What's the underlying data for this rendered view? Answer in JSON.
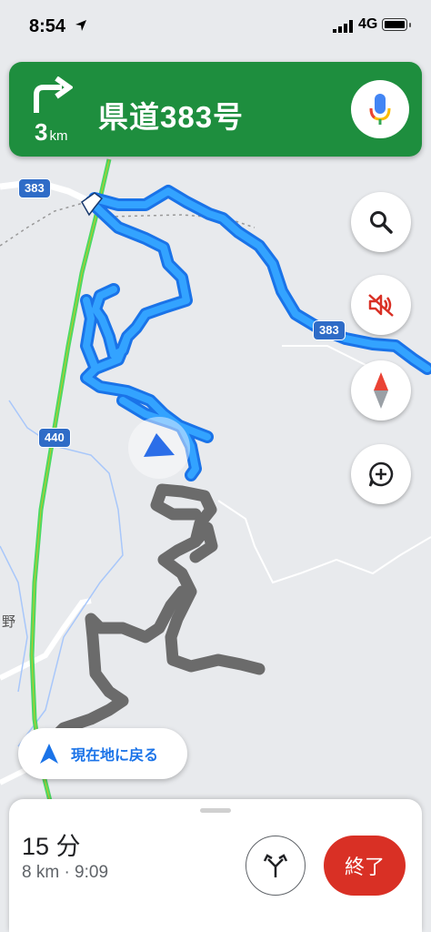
{
  "status_bar": {
    "time": "8:54",
    "network": "4G"
  },
  "navigation": {
    "turn_distance_value": "3",
    "turn_distance_unit": "km",
    "road_name": "県道383号",
    "turn_icon": "turn-right-icon"
  },
  "map": {
    "shields": [
      "383",
      "383",
      "440"
    ],
    "place_label": "野"
  },
  "recenter": {
    "label": "現在地に戻る"
  },
  "trip": {
    "duration": "15 分",
    "details": "8 km · 9:09",
    "end_label": "終了"
  },
  "colors": {
    "banner": "#1e8e3e",
    "route_active": "#1a8ef0",
    "route_traveled": "#6b6b6b",
    "end_button": "#d93025",
    "highway": "#4cd964",
    "shield": "#2f6cc7"
  }
}
